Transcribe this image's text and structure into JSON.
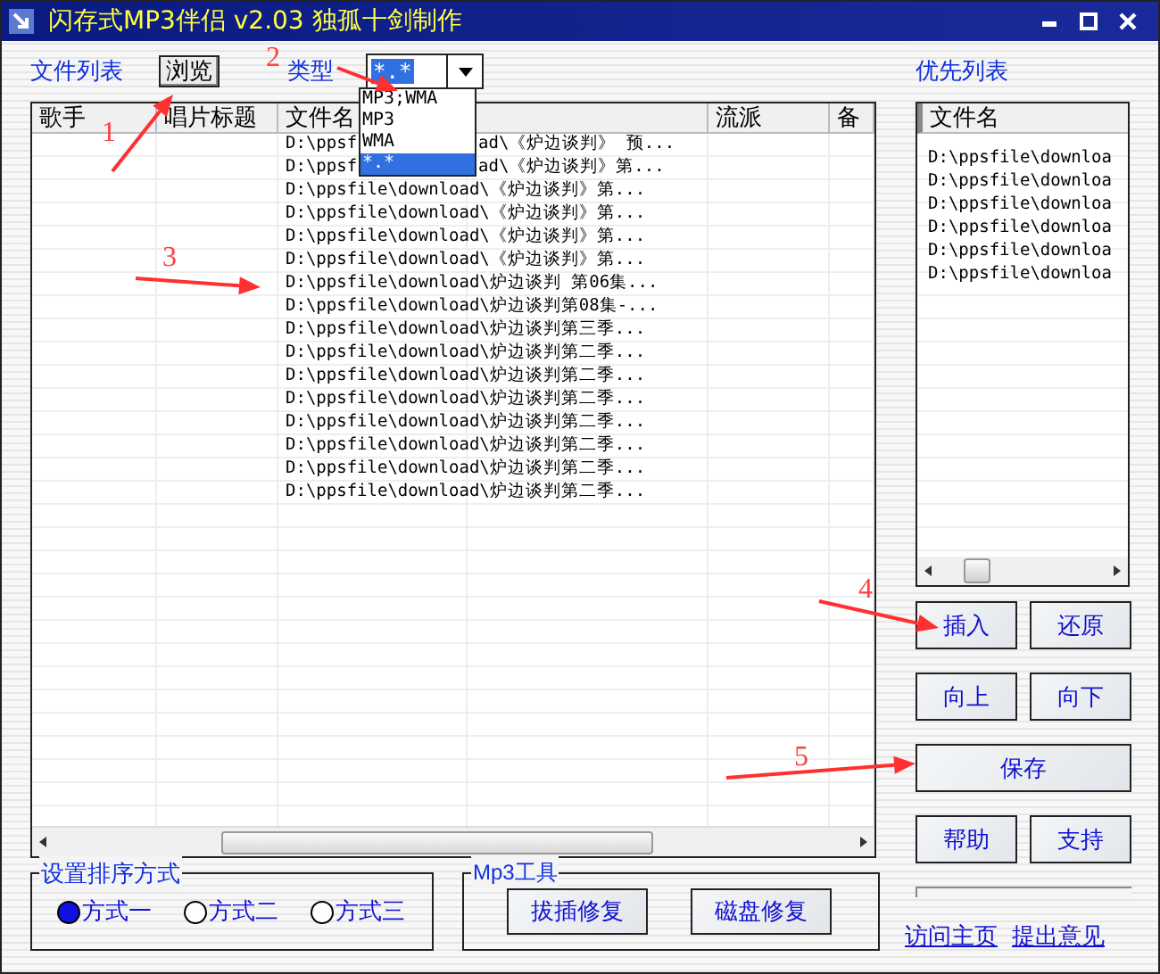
{
  "window": {
    "title": "闪存式MP3伴侣 v2.03 独孤十剑制作"
  },
  "toolbar": {
    "file_list_label": "文件列表",
    "browse_button": "浏览",
    "type_label": "类型",
    "type_combo": {
      "value": "*.*",
      "options": [
        {
          "label": "MP3;WMA",
          "selected": false
        },
        {
          "label": "MP3",
          "selected": false
        },
        {
          "label": "WMA",
          "selected": false
        },
        {
          "label": "*.*",
          "selected": true
        }
      ]
    }
  },
  "priority_label": "优先列表",
  "table": {
    "columns": [
      {
        "kind": "text",
        "label": "歌手"
      },
      {
        "kind": "text",
        "label": "唱片标题"
      },
      {
        "kind": "text",
        "label": "文件名"
      },
      {
        "kind": "blank"
      },
      {
        "kind": "text",
        "label": "流派"
      },
      {
        "kind": "text",
        "label": "备"
      }
    ],
    "rows": [
      {
        "file_parts": [
          "D:\\ppsf",
          "ad\\《炉边谈判》 预..."
        ]
      },
      {
        "file_parts": [
          "D:\\ppsf",
          "ad\\《炉边谈判》第..."
        ]
      },
      {
        "file": "D:\\ppsfile\\download\\《炉边谈判》第..."
      },
      {
        "file": "D:\\ppsfile\\download\\《炉边谈判》第..."
      },
      {
        "file": "D:\\ppsfile\\download\\《炉边谈判》第..."
      },
      {
        "file": "D:\\ppsfile\\download\\《炉边谈判》第..."
      },
      {
        "file": "D:\\ppsfile\\download\\炉边谈判 第06集..."
      },
      {
        "file": "D:\\ppsfile\\download\\炉边谈判第08集-..."
      },
      {
        "file": "D:\\ppsfile\\download\\炉边谈判第三季..."
      },
      {
        "file": "D:\\ppsfile\\download\\炉边谈判第二季..."
      },
      {
        "file": "D:\\ppsfile\\download\\炉边谈判第二季..."
      },
      {
        "file": "D:\\ppsfile\\download\\炉边谈判第二季..."
      },
      {
        "file": "D:\\ppsfile\\download\\炉边谈判第二季..."
      },
      {
        "file": "D:\\ppsfile\\download\\炉边谈判第二季..."
      },
      {
        "file": "D:\\ppsfile\\download\\炉边谈判第二季..."
      },
      {
        "file": "D:\\ppsfile\\download\\炉边谈判第二季..."
      }
    ]
  },
  "priority_list": {
    "column": "文件名",
    "rows": [
      "D:\\ppsfile\\downloa",
      "D:\\ppsfile\\downloa",
      "D:\\ppsfile\\downloa",
      "D:\\ppsfile\\downloa",
      "D:\\ppsfile\\downloa",
      "D:\\ppsfile\\downloa"
    ]
  },
  "side_buttons": [
    {
      "kind": "half",
      "label": "插入"
    },
    {
      "kind": "half",
      "label": "还原"
    },
    {
      "kind": "half",
      "label": "向上"
    },
    {
      "kind": "half",
      "label": "向下"
    },
    {
      "kind": "wide",
      "label": "保存"
    },
    {
      "kind": "half",
      "label": "帮助"
    },
    {
      "kind": "half",
      "label": "支持"
    }
  ],
  "sort_group": {
    "title": "设置排序方式",
    "options": [
      {
        "label": "方式一",
        "selected": true
      },
      {
        "label": "方式二",
        "selected": false
      },
      {
        "label": "方式三",
        "selected": false
      }
    ]
  },
  "tools_group": {
    "title": "Mp3工具",
    "buttons": [
      "拔插修复",
      "磁盘修复"
    ]
  },
  "links": [
    "访问主页",
    "提出意见"
  ],
  "annotations": [
    {
      "label": "1"
    },
    {
      "label": "2"
    },
    {
      "label": "3"
    },
    {
      "label": "4"
    },
    {
      "label": "5"
    }
  ]
}
